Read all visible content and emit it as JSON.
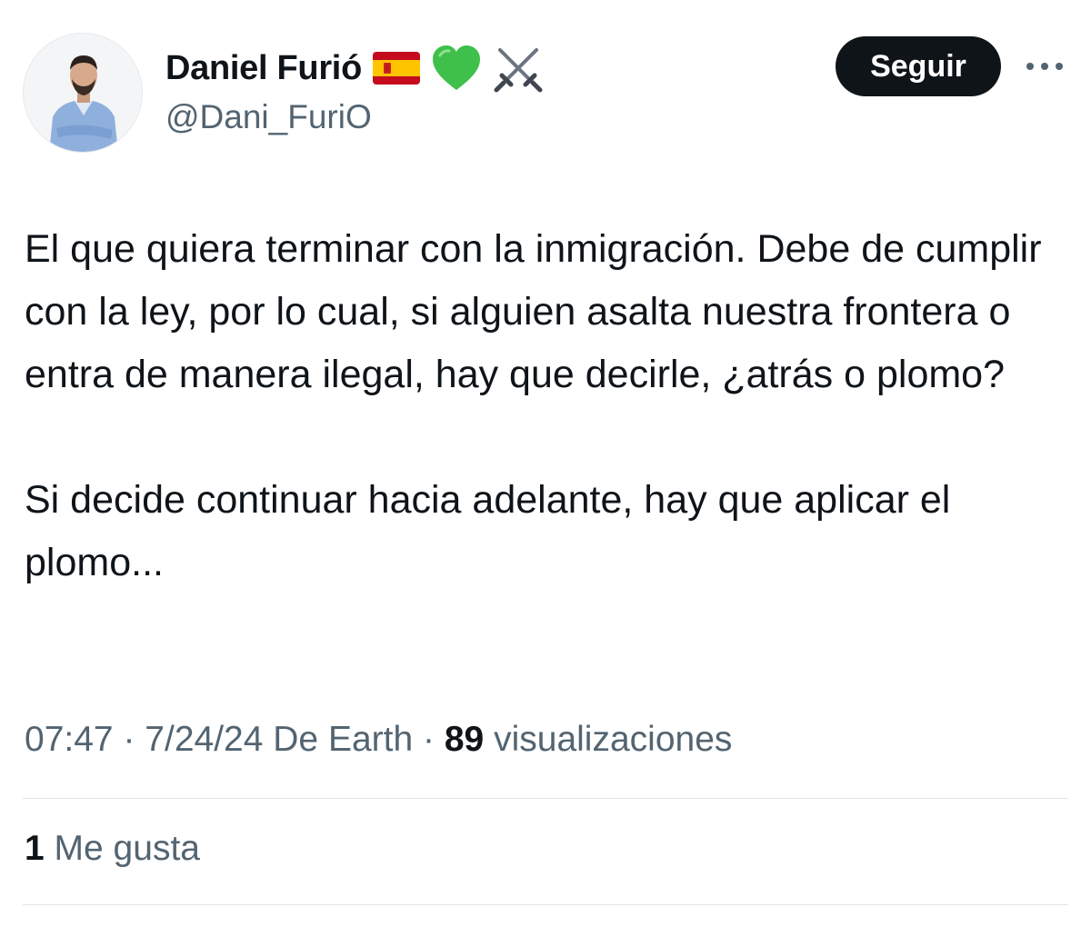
{
  "author": {
    "display_name": "Daniel Furió",
    "handle": "@Dani_FuriO",
    "name_emojis": [
      "flag-spain-icon",
      "green-heart-icon",
      "crossed-swords-icon"
    ]
  },
  "header": {
    "follow_label": "Seguir",
    "more_icon": "more-dots-icon"
  },
  "tweet": {
    "paragraph_1": "El que quiera terminar con la inmigración. Debe de cumplir con la ley, por lo cual, si alguien asalta nuestra frontera o entra de manera ilegal, hay que decirle, ¿atrás o plomo?",
    "paragraph_2": "Si decide continuar hacia adelante, hay que aplicar el plomo..."
  },
  "meta": {
    "time": "07:47",
    "separator": "·",
    "date": "7/24/24",
    "source": "De Earth",
    "views_count": "89",
    "views_label": "visualizaciones"
  },
  "engagement": {
    "likes_count": "1",
    "likes_label": "Me gusta"
  },
  "colors": {
    "text_primary": "#0f1419",
    "text_secondary": "#536471",
    "button_bg": "#0f1419",
    "divider": "#e1e5e8"
  }
}
